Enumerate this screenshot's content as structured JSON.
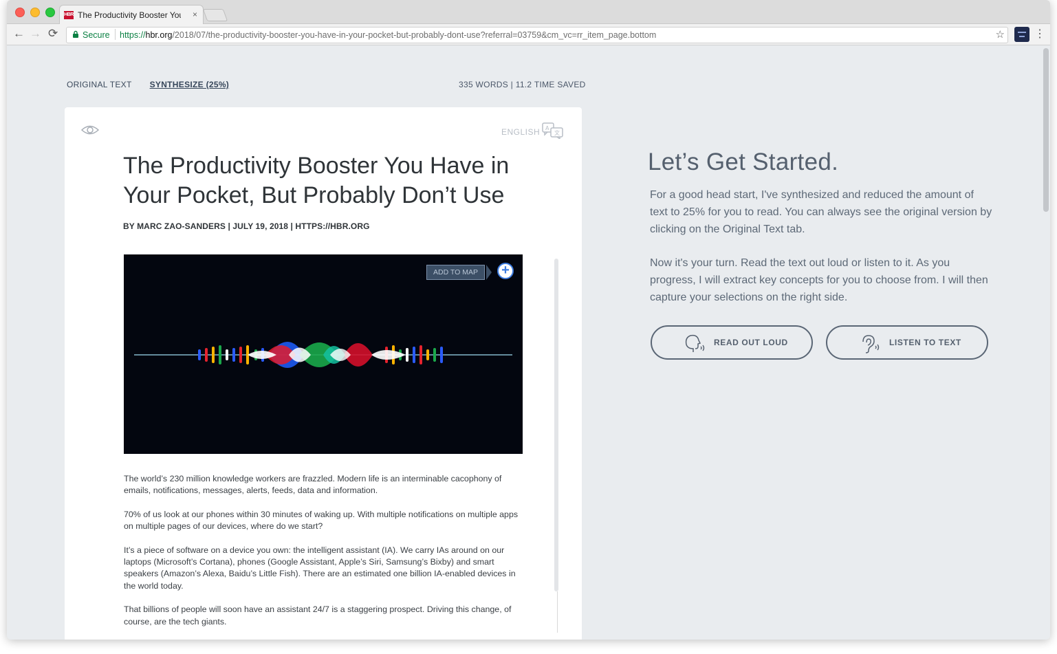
{
  "browser": {
    "tab_title": "The Productivity Booster You H",
    "tab_favicon_text": "HBR",
    "tab_close": "×",
    "secure_label": "Secure",
    "url_scheme": "https://",
    "url_host": "hbr.org",
    "url_path": "/2018/07/the-productivity-booster-you-have-in-your-pocket-but-probably-dont-use?referral=03759&cm_vc=rr_item_page.bottom",
    "icons": [
      "back-icon",
      "forward-icon",
      "reload-icon",
      "lock-icon",
      "star-icon",
      "extension-icon",
      "menu-icon"
    ]
  },
  "view_tabs": {
    "original": "ORIGINAL TEXT",
    "synthesize": "SYNTHESIZE (25%)"
  },
  "stats": "335 WORDS | 11.2 TIME SAVED",
  "card": {
    "language": "ENGLISH",
    "title": "The Productivity Booster You Have in Your Pocket, But Probably Don’t Use",
    "byline": "BY MARC ZAO-SANDERS | JULY 19, 2018 | HTTPS://HBR.ORG",
    "add_to_map": "ADD TO MAP",
    "plus": "+",
    "paragraphs": [
      "The world’s 230 million knowledge workers are frazzled. Modern life is an interminable cacophony of emails, notifications, messages, alerts, feeds, data and information.",
      "70% of us look at our phones within 30 minutes of waking up. With multiple notifications on multiple apps on multiple pages of our devices, where do we start?",
      "It’s a piece of software on a device you own: the intelligent assistant (IA). We carry IAs around on our laptops (Microsoft’s Cortana), phones (Google Assistant, Apple’s Siri, Samsung’s Bixby) and smart speakers (Amazon’s Alexa, Baidu’s Little Fish). There are an estimated one billion IA-enabled devices in the world today.",
      "That billions of people will soon have an assistant 24/7 is a staggering prospect. Driving this change, of course, are the tech giants."
    ]
  },
  "panel": {
    "title": "Let’s Get Started.",
    "text1": "For a good head start, I've synthesized and reduced the amount of text to 25% for you to read. You can always see the original version by clicking on the Original Text tab.",
    "text2": "Now it's your turn. Read the text out loud or listen to it. As you progress, I will extract key concepts for you to choose from. I will then capture your selections on the right side.",
    "read_button": "READ OUT LOUD",
    "listen_button": "LISTEN TO TEXT"
  },
  "colors": {
    "page_bg": "#e9ecef",
    "accent_blue": "#3d7ce0",
    "secure_green": "#0b8043",
    "text_slate": "#55606e"
  }
}
